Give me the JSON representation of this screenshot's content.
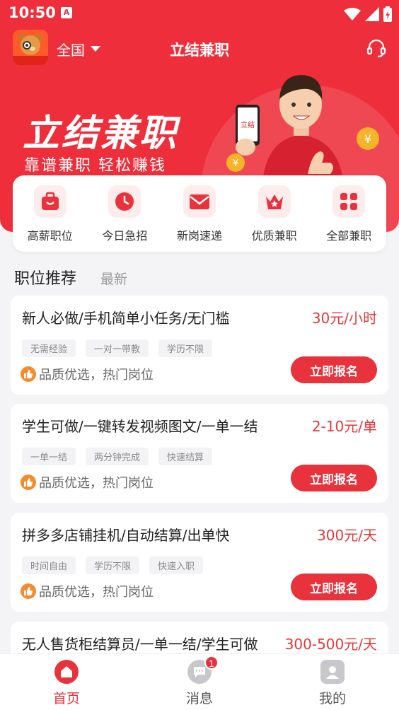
{
  "status": {
    "time": "10:50",
    "notif": "A"
  },
  "header": {
    "city": "全国",
    "title": "立结兼职"
  },
  "banner": {
    "title": "立结兼职",
    "subtitle": "靠谱兼职  轻松赚钱",
    "phone_text": "立结"
  },
  "categories": [
    {
      "label": "高薪职位",
      "icon": "bag-icon"
    },
    {
      "label": "今日急招",
      "icon": "clock-icon"
    },
    {
      "label": "新岗速递",
      "icon": "envelope-icon"
    },
    {
      "label": "优质兼职",
      "icon": "crown-icon"
    },
    {
      "label": "全部兼职",
      "icon": "grid-icon"
    }
  ],
  "tabs": {
    "active": "职位推荐",
    "other": "最新"
  },
  "jobs": [
    {
      "title": "新人必做/手机简单小任务/无门槛",
      "pay": "30元/小时",
      "tags": [
        "无需经验",
        "一对一带教",
        "学历不限"
      ],
      "quality": "品质优选，热门岗位",
      "apply": "立即报名"
    },
    {
      "title": "学生可做/一键转发视频图文/一单一结",
      "pay": "2-10元/单",
      "tags": [
        "一单一结",
        "两分钟完成",
        "快速结算"
      ],
      "quality": "品质优选，热门岗位",
      "apply": "立即报名"
    },
    {
      "title": "拼多多店铺挂机/自动结算/出单快",
      "pay": "300元/天",
      "tags": [
        "时间自由",
        "学历不限",
        "快速入职"
      ],
      "quality": "品质优选，热门岗位",
      "apply": "立即报名"
    },
    {
      "title": "无人售货柜结算员/一单一结/学生可做",
      "pay": "300-500元/天",
      "tags": [],
      "quality": "",
      "apply": ""
    }
  ],
  "bottom_nav": [
    {
      "label": "首页",
      "icon": "home-icon",
      "active": true
    },
    {
      "label": "消息",
      "icon": "message-icon",
      "badge": "1"
    },
    {
      "label": "我的",
      "icon": "profile-icon"
    }
  ],
  "colors": {
    "brand": "#ee2f3b",
    "button": "#e8323c",
    "price": "#e53838"
  }
}
